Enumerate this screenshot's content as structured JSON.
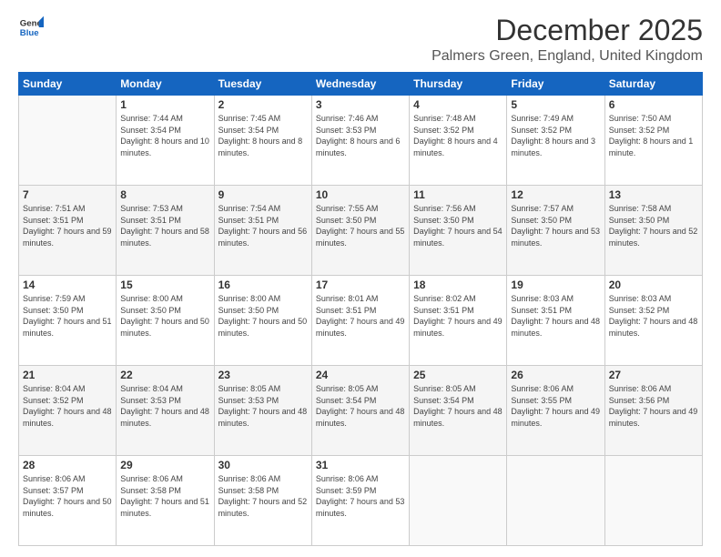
{
  "logo": {
    "line1": "General",
    "line2": "Blue"
  },
  "title": "December 2025",
  "location": "Palmers Green, England, United Kingdom",
  "days_of_week": [
    "Sunday",
    "Monday",
    "Tuesday",
    "Wednesday",
    "Thursday",
    "Friday",
    "Saturday"
  ],
  "weeks": [
    [
      {
        "day": "",
        "sunrise": "",
        "sunset": "",
        "daylight": ""
      },
      {
        "day": "1",
        "sunrise": "Sunrise: 7:44 AM",
        "sunset": "Sunset: 3:54 PM",
        "daylight": "Daylight: 8 hours and 10 minutes."
      },
      {
        "day": "2",
        "sunrise": "Sunrise: 7:45 AM",
        "sunset": "Sunset: 3:54 PM",
        "daylight": "Daylight: 8 hours and 8 minutes."
      },
      {
        "day": "3",
        "sunrise": "Sunrise: 7:46 AM",
        "sunset": "Sunset: 3:53 PM",
        "daylight": "Daylight: 8 hours and 6 minutes."
      },
      {
        "day": "4",
        "sunrise": "Sunrise: 7:48 AM",
        "sunset": "Sunset: 3:52 PM",
        "daylight": "Daylight: 8 hours and 4 minutes."
      },
      {
        "day": "5",
        "sunrise": "Sunrise: 7:49 AM",
        "sunset": "Sunset: 3:52 PM",
        "daylight": "Daylight: 8 hours and 3 minutes."
      },
      {
        "day": "6",
        "sunrise": "Sunrise: 7:50 AM",
        "sunset": "Sunset: 3:52 PM",
        "daylight": "Daylight: 8 hours and 1 minute."
      }
    ],
    [
      {
        "day": "7",
        "sunrise": "Sunrise: 7:51 AM",
        "sunset": "Sunset: 3:51 PM",
        "daylight": "Daylight: 7 hours and 59 minutes."
      },
      {
        "day": "8",
        "sunrise": "Sunrise: 7:53 AM",
        "sunset": "Sunset: 3:51 PM",
        "daylight": "Daylight: 7 hours and 58 minutes."
      },
      {
        "day": "9",
        "sunrise": "Sunrise: 7:54 AM",
        "sunset": "Sunset: 3:51 PM",
        "daylight": "Daylight: 7 hours and 56 minutes."
      },
      {
        "day": "10",
        "sunrise": "Sunrise: 7:55 AM",
        "sunset": "Sunset: 3:50 PM",
        "daylight": "Daylight: 7 hours and 55 minutes."
      },
      {
        "day": "11",
        "sunrise": "Sunrise: 7:56 AM",
        "sunset": "Sunset: 3:50 PM",
        "daylight": "Daylight: 7 hours and 54 minutes."
      },
      {
        "day": "12",
        "sunrise": "Sunrise: 7:57 AM",
        "sunset": "Sunset: 3:50 PM",
        "daylight": "Daylight: 7 hours and 53 minutes."
      },
      {
        "day": "13",
        "sunrise": "Sunrise: 7:58 AM",
        "sunset": "Sunset: 3:50 PM",
        "daylight": "Daylight: 7 hours and 52 minutes."
      }
    ],
    [
      {
        "day": "14",
        "sunrise": "Sunrise: 7:59 AM",
        "sunset": "Sunset: 3:50 PM",
        "daylight": "Daylight: 7 hours and 51 minutes."
      },
      {
        "day": "15",
        "sunrise": "Sunrise: 8:00 AM",
        "sunset": "Sunset: 3:50 PM",
        "daylight": "Daylight: 7 hours and 50 minutes."
      },
      {
        "day": "16",
        "sunrise": "Sunrise: 8:00 AM",
        "sunset": "Sunset: 3:50 PM",
        "daylight": "Daylight: 7 hours and 50 minutes."
      },
      {
        "day": "17",
        "sunrise": "Sunrise: 8:01 AM",
        "sunset": "Sunset: 3:51 PM",
        "daylight": "Daylight: 7 hours and 49 minutes."
      },
      {
        "day": "18",
        "sunrise": "Sunrise: 8:02 AM",
        "sunset": "Sunset: 3:51 PM",
        "daylight": "Daylight: 7 hours and 49 minutes."
      },
      {
        "day": "19",
        "sunrise": "Sunrise: 8:03 AM",
        "sunset": "Sunset: 3:51 PM",
        "daylight": "Daylight: 7 hours and 48 minutes."
      },
      {
        "day": "20",
        "sunrise": "Sunrise: 8:03 AM",
        "sunset": "Sunset: 3:52 PM",
        "daylight": "Daylight: 7 hours and 48 minutes."
      }
    ],
    [
      {
        "day": "21",
        "sunrise": "Sunrise: 8:04 AM",
        "sunset": "Sunset: 3:52 PM",
        "daylight": "Daylight: 7 hours and 48 minutes."
      },
      {
        "day": "22",
        "sunrise": "Sunrise: 8:04 AM",
        "sunset": "Sunset: 3:53 PM",
        "daylight": "Daylight: 7 hours and 48 minutes."
      },
      {
        "day": "23",
        "sunrise": "Sunrise: 8:05 AM",
        "sunset": "Sunset: 3:53 PM",
        "daylight": "Daylight: 7 hours and 48 minutes."
      },
      {
        "day": "24",
        "sunrise": "Sunrise: 8:05 AM",
        "sunset": "Sunset: 3:54 PM",
        "daylight": "Daylight: 7 hours and 48 minutes."
      },
      {
        "day": "25",
        "sunrise": "Sunrise: 8:05 AM",
        "sunset": "Sunset: 3:54 PM",
        "daylight": "Daylight: 7 hours and 48 minutes."
      },
      {
        "day": "26",
        "sunrise": "Sunrise: 8:06 AM",
        "sunset": "Sunset: 3:55 PM",
        "daylight": "Daylight: 7 hours and 49 minutes."
      },
      {
        "day": "27",
        "sunrise": "Sunrise: 8:06 AM",
        "sunset": "Sunset: 3:56 PM",
        "daylight": "Daylight: 7 hours and 49 minutes."
      }
    ],
    [
      {
        "day": "28",
        "sunrise": "Sunrise: 8:06 AM",
        "sunset": "Sunset: 3:57 PM",
        "daylight": "Daylight: 7 hours and 50 minutes."
      },
      {
        "day": "29",
        "sunrise": "Sunrise: 8:06 AM",
        "sunset": "Sunset: 3:58 PM",
        "daylight": "Daylight: 7 hours and 51 minutes."
      },
      {
        "day": "30",
        "sunrise": "Sunrise: 8:06 AM",
        "sunset": "Sunset: 3:58 PM",
        "daylight": "Daylight: 7 hours and 52 minutes."
      },
      {
        "day": "31",
        "sunrise": "Sunrise: 8:06 AM",
        "sunset": "Sunset: 3:59 PM",
        "daylight": "Daylight: 7 hours and 53 minutes."
      },
      {
        "day": "",
        "sunrise": "",
        "sunset": "",
        "daylight": ""
      },
      {
        "day": "",
        "sunrise": "",
        "sunset": "",
        "daylight": ""
      },
      {
        "day": "",
        "sunrise": "",
        "sunset": "",
        "daylight": ""
      }
    ]
  ]
}
